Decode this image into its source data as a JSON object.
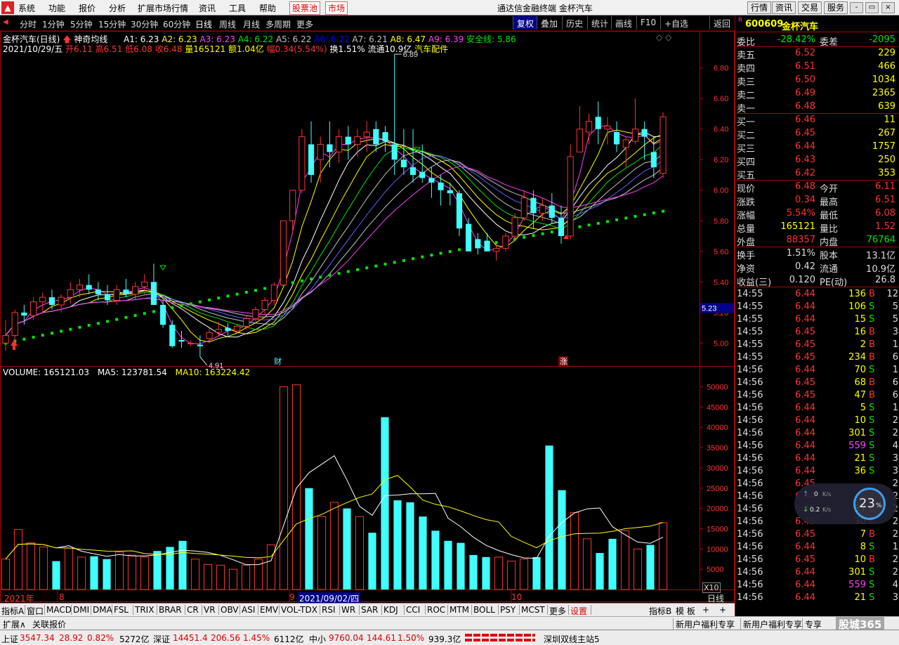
{
  "menubar": {
    "items": [
      "系统",
      "功能",
      "报价",
      "分析",
      "扩展市场行情",
      "资讯",
      "工具",
      "帮助"
    ],
    "highlight": [
      "股票池",
      "市场"
    ],
    "window_title": "通达信金融终端  金杯汽车",
    "right_buttons": [
      "行情",
      "资讯",
      "交易",
      "服务"
    ],
    "window_buttons": [
      "-",
      "▭",
      "×"
    ]
  },
  "toolbar": {
    "periods": [
      "分时",
      "1分钟",
      "5分钟",
      "15分钟",
      "30分钟",
      "60分钟",
      "日线",
      "周线",
      "月线",
      "多周期",
      "更多"
    ],
    "selected_period": "日线",
    "right": [
      "复权",
      "叠加",
      "历史",
      "统计",
      "画线",
      "F10",
      "+自选",
      "返回"
    ],
    "active_right": "复权"
  },
  "chart_header": {
    "name": "金杯汽车(日线)",
    "indicator": "神奇均线",
    "ma": [
      {
        "label": "A1: 6.23",
        "color": "#ffffff"
      },
      {
        "label": "A2: 6.23",
        "color": "#ffff00"
      },
      {
        "label": "A3: 6.23",
        "color": "#ff40ff"
      },
      {
        "label": "A4: 6.22",
        "color": "#00e600"
      },
      {
        "label": "A5: 6.22",
        "color": "#c0c0c0"
      },
      {
        "label": "A6: 6.22",
        "color": "#0000ff"
      },
      {
        "label": "A7: 6.21",
        "color": "#c0c0c0"
      },
      {
        "label": "A8: 6.47",
        "color": "#ffff00"
      },
      {
        "label": "A9: 6.39",
        "color": "#ff40ff"
      },
      {
        "label": "安全线: 5.86",
        "color": "#00e600"
      }
    ],
    "line2": {
      "date": "2021/10/29/五",
      "open": "开6.11",
      "high": "高6.51",
      "low": "低6.08",
      "close": "收6.48",
      "vol": "量165121",
      "amount": "额1.04亿",
      "change": "幅0.34(5.54%)",
      "turnover": "换1.51%",
      "float": "流通10.9亿",
      "sector": "汽车配件"
    },
    "hi_label": "6.89",
    "lo_label": "4.91",
    "marker_cai": "财",
    "marker_zhang": "涨",
    "current_price_tag": "5.23"
  },
  "volume_header": {
    "vol": "VOLUME: 165121.03",
    "ma5": "MA5: 123781.54",
    "ma10": "MA10: 163224.42"
  },
  "price_axis": [
    "6.80",
    "6.60",
    "6.40",
    "6.20",
    "6.00",
    "5.80",
    "5.60",
    "5.40",
    "5.20",
    "5.00"
  ],
  "vol_axis": [
    "50000",
    "45000",
    "40000",
    "35000",
    "30000",
    "25000",
    "20000",
    "15000",
    "10000",
    "5000"
  ],
  "vol_axis_unit": "X10",
  "date_axis": {
    "year": "2021年",
    "m8": "8",
    "m9": "9",
    "cursor": "2021/09/02/四",
    "m10": "10",
    "period": "日线"
  },
  "chart_data": {
    "type": "candlestick",
    "ylim": [
      4.85,
      6.95
    ],
    "vol_ylim": [
      0,
      52000
    ],
    "candles": [
      [
        5.0,
        5.15,
        4.95,
        5.05
      ],
      [
        5.05,
        5.22,
        5.0,
        5.2
      ],
      [
        5.2,
        5.25,
        5.12,
        5.18
      ],
      [
        5.18,
        5.3,
        5.15,
        5.27
      ],
      [
        5.27,
        5.33,
        5.2,
        5.3
      ],
      [
        5.3,
        5.35,
        5.22,
        5.25
      ],
      [
        5.25,
        5.32,
        5.2,
        5.3
      ],
      [
        5.3,
        5.4,
        5.26,
        5.35
      ],
      [
        5.35,
        5.42,
        5.3,
        5.38
      ],
      [
        5.38,
        5.45,
        5.32,
        5.35
      ],
      [
        5.35,
        5.4,
        5.28,
        5.32
      ],
      [
        5.32,
        5.38,
        5.25,
        5.28
      ],
      [
        5.28,
        5.38,
        5.25,
        5.35
      ],
      [
        5.35,
        5.42,
        5.3,
        5.32
      ],
      [
        5.32,
        5.4,
        5.28,
        5.37
      ],
      [
        5.37,
        5.45,
        5.32,
        5.4
      ],
      [
        5.4,
        5.52,
        5.25,
        5.25
      ],
      [
        5.25,
        5.28,
        5.1,
        5.12
      ],
      [
        5.12,
        5.15,
        4.97,
        4.98
      ],
      [
        5.02,
        5.08,
        4.97,
        5.01
      ],
      [
        5.0,
        5.02,
        4.98,
        5.0
      ],
      [
        4.99,
        5.05,
        4.91,
        4.98
      ],
      [
        5.03,
        5.1,
        5.0,
        5.07
      ],
      [
        5.07,
        5.14,
        5.05,
        5.09
      ],
      [
        5.1,
        5.13,
        5.05,
        5.08
      ],
      [
        5.08,
        5.12,
        5.06,
        5.11
      ],
      [
        5.11,
        5.18,
        5.09,
        5.16
      ],
      [
        5.16,
        5.24,
        5.14,
        5.22
      ],
      [
        5.22,
        5.3,
        5.18,
        5.28
      ],
      [
        5.28,
        5.4,
        5.25,
        5.38
      ],
      [
        5.38,
        5.8,
        5.37,
        5.8
      ],
      [
        5.8,
        6.0,
        5.72,
        6.0
      ],
      [
        6.0,
        6.4,
        5.98,
        6.35
      ],
      [
        6.3,
        6.45,
        6.05,
        6.1
      ],
      [
        6.2,
        6.35,
        6.05,
        6.3
      ],
      [
        6.3,
        6.45,
        6.15,
        6.25
      ],
      [
        6.25,
        6.4,
        6.18,
        6.35
      ],
      [
        6.35,
        6.42,
        6.2,
        6.3
      ],
      [
        6.3,
        6.4,
        6.22,
        6.35
      ],
      [
        6.35,
        6.45,
        6.25,
        6.38
      ],
      [
        6.4,
        6.45,
        6.25,
        6.3
      ],
      [
        6.38,
        6.42,
        6.25,
        6.32
      ],
      [
        6.3,
        6.89,
        6.1,
        6.2
      ],
      [
        6.2,
        6.4,
        6.1,
        6.15
      ],
      [
        6.15,
        6.4,
        6.05,
        6.1
      ],
      [
        6.12,
        6.3,
        6.05,
        6.08
      ],
      [
        6.08,
        6.15,
        5.95,
        6.05
      ],
      [
        6.05,
        6.1,
        5.9,
        6.0
      ],
      [
        6.0,
        6.05,
        5.9,
        5.98
      ],
      [
        5.98,
        6.0,
        5.7,
        5.75
      ],
      [
        5.78,
        5.82,
        5.6,
        5.6
      ],
      [
        5.68,
        5.72,
        5.58,
        5.62
      ],
      [
        5.67,
        5.72,
        5.6,
        5.6
      ],
      [
        5.6,
        5.65,
        5.54,
        5.62
      ],
      [
        5.62,
        5.72,
        5.6,
        5.7
      ],
      [
        5.7,
        5.85,
        5.68,
        5.82
      ],
      [
        5.82,
        6.0,
        5.8,
        5.95
      ],
      [
        5.95,
        6.0,
        5.75,
        5.85
      ],
      [
        5.85,
        5.95,
        5.8,
        5.9
      ],
      [
        5.9,
        5.98,
        5.78,
        5.82
      ],
      [
        5.82,
        5.9,
        5.65,
        5.7
      ],
      [
        5.7,
        6.3,
        5.68,
        6.22
      ],
      [
        6.25,
        6.55,
        6.25,
        6.4
      ],
      [
        6.38,
        6.5,
        6.3,
        6.45
      ],
      [
        6.48,
        6.58,
        6.3,
        6.4
      ],
      [
        6.4,
        6.48,
        6.3,
        6.42
      ],
      [
        6.38,
        6.45,
        6.25,
        6.3
      ],
      [
        6.28,
        6.35,
        6.15,
        6.33
      ],
      [
        6.32,
        6.6,
        6.3,
        6.4
      ],
      [
        6.4,
        6.45,
        6.2,
        6.35
      ],
      [
        6.25,
        6.35,
        6.08,
        6.15
      ],
      [
        6.11,
        6.51,
        6.08,
        6.48
      ]
    ],
    "volume": [
      7500,
      14800,
      11500,
      10500,
      7000,
      10200,
      8000,
      8200,
      7500,
      9200,
      8500,
      8000,
      9500,
      10500,
      12000,
      7500,
      6200,
      6000,
      5000,
      6000,
      7500,
      11000,
      50000,
      50500,
      25000,
      18000,
      21500,
      20000,
      18000,
      14000,
      42500,
      22000,
      21500,
      18000,
      14500,
      12000,
      11500,
      8500,
      8000,
      8000,
      7000,
      7500,
      8000,
      35500,
      24500,
      19000,
      12500,
      9000,
      12500,
      14500,
      10000,
      11000,
      16500
    ]
  },
  "rpanel": {
    "code": "600609",
    "name": "金杯汽车",
    "weibi_label": "委比",
    "weibi": "-28.42%",
    "weicha_label": "委差",
    "weicha": "-2095",
    "asks": [
      {
        "label": "卖五",
        "price": "6.52",
        "vol": "229"
      },
      {
        "label": "卖四",
        "price": "6.51",
        "vol": "466"
      },
      {
        "label": "卖三",
        "price": "6.50",
        "vol": "1034"
      },
      {
        "label": "卖二",
        "price": "6.49",
        "vol": "2365"
      },
      {
        "label": "卖一",
        "price": "6.48",
        "vol": "639"
      }
    ],
    "bids": [
      {
        "label": "买一",
        "price": "6.46",
        "vol": "11"
      },
      {
        "label": "买二",
        "price": "6.45",
        "vol": "267"
      },
      {
        "label": "买三",
        "price": "6.44",
        "vol": "1757"
      },
      {
        "label": "买四",
        "price": "6.43",
        "vol": "250"
      },
      {
        "label": "买五",
        "price": "6.42",
        "vol": "353"
      }
    ],
    "stats": [
      {
        "l1": "现价",
        "v1": "6.48",
        "c1": "red",
        "l2": "今开",
        "v2": "6.11",
        "c2": "red"
      },
      {
        "l1": "涨跌",
        "v1": "0.34",
        "c1": "red",
        "l2": "最高",
        "v2": "6.51",
        "c2": "red"
      },
      {
        "l1": "涨幅",
        "v1": "5.54%",
        "c1": "red",
        "l2": "最低",
        "v2": "6.08",
        "c2": "red"
      },
      {
        "l1": "总量",
        "v1": "165121",
        "c1": "yel",
        "l2": "量比",
        "v2": "1.52",
        "c2": "red"
      },
      {
        "l1": "外盘",
        "v1": "88357",
        "c1": "red",
        "l2": "内盘",
        "v2": "76764",
        "c2": "grn"
      }
    ],
    "stats2": [
      {
        "l1": "换手",
        "v1": "1.51%",
        "l2": "股本",
        "v2": "13.1亿"
      },
      {
        "l1": "净资",
        "v1": "0.42",
        "l2": "流通",
        "v2": "10.9亿"
      },
      {
        "l1": "收益(三)",
        "v1": "0.120",
        "l2": "PE(动)",
        "v2": "26.8"
      }
    ],
    "ticks": [
      {
        "t": "14:55",
        "p": "6.44",
        "v": "136",
        "s": "B",
        "n": "12"
      },
      {
        "t": "14:55",
        "p": "6.44",
        "v": "106",
        "s": "S",
        "n": "5"
      },
      {
        "t": "14:55",
        "p": "6.44",
        "v": "15",
        "s": "S",
        "n": "5"
      },
      {
        "t": "14:55",
        "p": "6.45",
        "v": "16",
        "s": "B",
        "n": "3"
      },
      {
        "t": "14:55",
        "p": "6.45",
        "v": "2",
        "s": "B",
        "n": "1"
      },
      {
        "t": "14:55",
        "p": "6.45",
        "v": "234",
        "s": "B",
        "n": "6"
      },
      {
        "t": "14:56",
        "p": "6.44",
        "v": "70",
        "s": "S",
        "n": "1"
      },
      {
        "t": "14:56",
        "p": "6.45",
        "v": "68",
        "s": "B",
        "n": "6"
      },
      {
        "t": "14:56",
        "p": "6.45",
        "v": "47",
        "s": "B",
        "n": "6"
      },
      {
        "t": "14:56",
        "p": "6.44",
        "v": "5",
        "s": "S",
        "n": "1"
      },
      {
        "t": "14:56",
        "p": "6.44",
        "v": "10",
        "s": "S",
        "n": "2"
      },
      {
        "t": "14:56",
        "p": "6.44",
        "v": "301",
        "s": "S",
        "n": "2"
      },
      {
        "t": "14:56",
        "p": "6.44",
        "v": "559",
        "s": "S",
        "n": "4"
      },
      {
        "t": "14:56",
        "p": "6.44",
        "v": "21",
        "s": "S",
        "n": "3"
      },
      {
        "t": "14:56",
        "p": "6.44",
        "v": "36",
        "s": "S",
        "n": "3"
      },
      {
        "t": "14:56",
        "p": "6.45",
        "v": "",
        "s": "",
        "n": "2"
      },
      {
        "t": "14:56",
        "p": "6.44",
        "v": "",
        "s": "",
        "n": "2"
      },
      {
        "t": "14:56",
        "p": "6.45",
        "v": "37",
        "s": "B",
        "n": "2"
      },
      {
        "t": "14:56",
        "p": "6.45",
        "v": "30",
        "s": "B",
        "n": "2"
      },
      {
        "t": "14:56",
        "p": "6.45",
        "v": "7",
        "s": "B",
        "n": "2"
      },
      {
        "t": "14:56",
        "p": "6.44",
        "v": "8",
        "s": "S",
        "n": "1"
      },
      {
        "t": "14:56",
        "p": "6.45",
        "v": "10",
        "s": "B",
        "n": "2"
      },
      {
        "t": "14:56",
        "p": "6.44",
        "v": "301",
        "s": "S",
        "n": "2"
      },
      {
        "t": "14:56",
        "p": "6.44",
        "v": "559",
        "s": "S",
        "n": "4"
      },
      {
        "t": "14:56",
        "p": "6.44",
        "v": "21",
        "s": "S",
        "n": "3"
      }
    ],
    "net_widget": {
      "up": "0",
      "up_unit": "K/s",
      "down": "0.2",
      "down_unit": "K/s",
      "cpu": "23",
      "cpu_unit": "%"
    }
  },
  "bottomtabs": [
    "指标A",
    "窗口",
    "MACD",
    "DMI",
    "DMA",
    "FSL",
    "TRIX",
    "BRAR",
    "CR",
    "VR",
    "OBV",
    "ASI",
    "EMV",
    "VOL-TDX",
    "RSI",
    "WR",
    "SAR",
    "KDJ",
    "CCI",
    "ROC",
    "MTM",
    "BOLL",
    "PSY",
    "MCST",
    "更多",
    "设置"
  ],
  "bottom_right": [
    "指标B",
    "模 板",
    "+",
    "+"
  ],
  "expbar": {
    "left": [
      "扩展∧",
      "关联报价"
    ],
    "right": [
      "新用户福利专享",
      "新用户福利专享",
      "专享",
      "新用户福利专享"
    ],
    "watermark": "股城365"
  },
  "statusbar": {
    "sh": {
      "name": "上证",
      "val": "3547.34",
      "chg": "28.92",
      "pct": "0.82%",
      "amt": "5272亿"
    },
    "sz": {
      "name": "深证",
      "val": "14451.4",
      "chg": "206.56",
      "pct": "1.45%",
      "amt": "6112亿"
    },
    "zx": {
      "name": "中小",
      "val": "9760.04",
      "chg": "144.61",
      "pct": "1.50%",
      "amt": "939.3亿"
    },
    "server": "深圳双线主站5"
  }
}
